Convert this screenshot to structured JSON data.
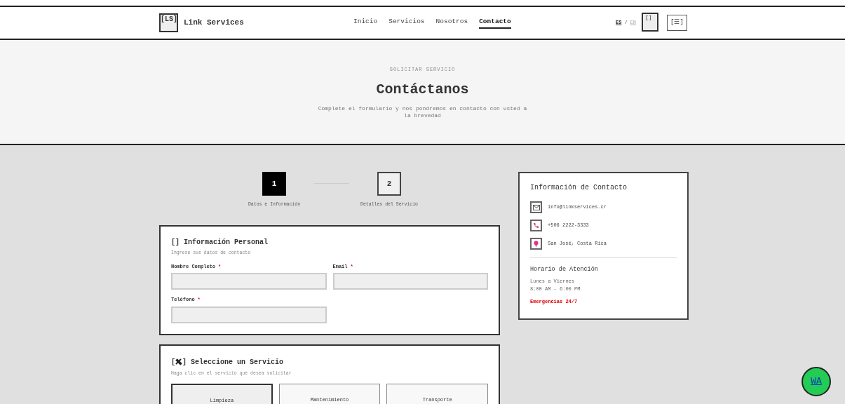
{
  "header": {
    "logo": "[LS]",
    "brand": "Link Services",
    "nav": [
      {
        "label": "Inicio",
        "selected": false
      },
      {
        "label": "Servicios",
        "selected": false
      },
      {
        "label": "Nosotros",
        "selected": false
      },
      {
        "label": "Contacto",
        "selected": true
      }
    ],
    "languages": [
      {
        "label": "ES",
        "selected": true
      },
      {
        "label": "EN",
        "selected": false
      }
    ],
    "language_separator": "/",
    "theme_toggle": "[]",
    "menu_button": "[☰]"
  },
  "hero": {
    "eyebrow": "SOLICITAR SERVICIO",
    "title": "Contáctanos",
    "subtitle": "Complete el formulario y nos pondremos en contacto con usted a la brevedad"
  },
  "steps": [
    {
      "number": "1",
      "label": "Datos e Información",
      "selected": true
    },
    {
      "number": "2",
      "label": "Detalles del Servicio",
      "selected": false
    }
  ],
  "personal": {
    "title": "[] Información Personal",
    "subtitle": "Ingrese sus datos de contacto",
    "fields": [
      {
        "label": "Nombre Completo",
        "required": true
      },
      {
        "label": "Email",
        "required": true
      },
      {
        "label": "Teléfono",
        "required": true
      }
    ],
    "required_mark": "*"
  },
  "service": {
    "bracket_open": "[",
    "bracket_close": "]",
    "title": "Seleccione un Servicio",
    "subtitle": "Haga clic en el servicio que desea solicitar",
    "options": [
      {
        "label": "Limpieza",
        "selected": true
      },
      {
        "label": "Mantenimiento",
        "selected": false
      },
      {
        "label": "Transporte",
        "selected": false
      }
    ]
  },
  "contact": {
    "title": "Información de Contacto",
    "items": [
      {
        "kind": "email",
        "text": "info@linkservices.cr"
      },
      {
        "kind": "phone",
        "text": "+506 2222-3333"
      },
      {
        "kind": "location",
        "text": "San José, Costa Rica"
      }
    ],
    "hours_title": "Horario de Atención",
    "hours_days": "Lunes a Viernes",
    "hours_time": "8:00 AM - 6:00 PM",
    "emergency": "Emergencias 24/7"
  },
  "whatsapp": "WA"
}
